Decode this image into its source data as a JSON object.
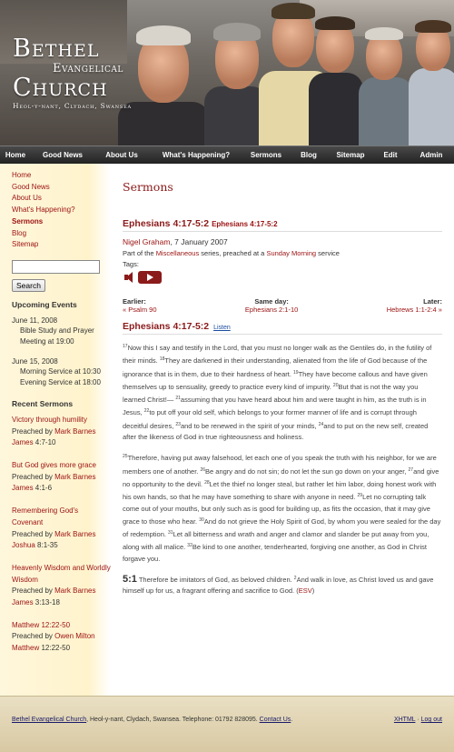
{
  "header": {
    "logo": {
      "line1": "Bethel",
      "line2": "Evangelical",
      "line3": "Church",
      "line4": "Heol-y-nant, Clydach, Swansea"
    }
  },
  "nav": [
    "Home",
    "Good News",
    "About Us",
    "What's Happening?",
    "Sermons",
    "Blog",
    "Sitemap",
    "Edit",
    "Admin"
  ],
  "sidebar": {
    "links": [
      "Home",
      "Good News",
      "About Us",
      "What's Happening?",
      "Sermons",
      "Blog",
      "Sitemap"
    ],
    "active": "Sermons",
    "search_button": "Search",
    "events_heading": "Upcoming Events",
    "events": [
      {
        "date": "June 11, 2008",
        "lines": [
          "Bible Study and Prayer",
          "Meeting at 19:00"
        ]
      },
      {
        "date": "June 15, 2008",
        "lines": [
          "Morning Service at 10:30",
          "Evening Service at 18:00"
        ]
      }
    ],
    "recent_heading": "Recent Sermons",
    "recent": [
      {
        "title": "Victory through humility",
        "by": "Preached by ",
        "preacher": "Mark Barnes",
        "ref_book": "James",
        "ref_rest": " 4:7-10"
      },
      {
        "title": "But God gives more grace",
        "by": "Preached by ",
        "preacher": "Mark Barnes",
        "ref_book": "James",
        "ref_rest": " 4:1-6"
      },
      {
        "title": "Remembering God's Covenant",
        "by": "Preached by ",
        "preacher": "Mark Barnes",
        "ref_book": "Joshua",
        "ref_rest": " 8:1-35"
      },
      {
        "title": "Heavenly Wisdom and Worldly Wisdom",
        "by": "Preached by ",
        "preacher": "Mark Barnes",
        "ref_book": "James",
        "ref_rest": " 3:13-18"
      },
      {
        "title": "Matthew 12:22-50",
        "by": "Preached by ",
        "preacher": "Owen Milton",
        "ref_book": "Matthew",
        "ref_rest": " 12:22-50"
      }
    ]
  },
  "main": {
    "page_title": "Sermons",
    "sermon_title": "Ephesians 4:17-5:2",
    "sermon_subtitle": "Ephesians 4:17-5:2",
    "preacher": "Nigel Graham",
    "date": ", 7 January 2007",
    "series_prefix": "Part of the ",
    "series": "Miscellaneous",
    "series_mid": " series, preached at a ",
    "service": "Sunday Morning",
    "series_suffix": " service",
    "tags_label": "Tags:",
    "earlier_label": "Earlier:",
    "earlier": "« Psalm 90",
    "sameday_label": "Same day:",
    "sameday": "Ephesians 2:1-10",
    "later_label": "Later:",
    "later": "Hebrews 1:1-2:4 »",
    "passage_heading": "Ephesians 4:17-5:2",
    "listen": "Listen",
    "para1": [
      {
        "n": "17",
        "t": "Now this I say and testify in the Lord, that you must no longer walk as the Gentiles do, in the futility of their minds. "
      },
      {
        "n": "18",
        "t": "They are darkened in their understanding, alienated from the life of God because of the ignorance that is in them, due to their hardness of heart. "
      },
      {
        "n": "19",
        "t": "They have become callous and have given themselves up to sensuality, greedy to practice every kind of impurity. "
      },
      {
        "n": "20",
        "t": "But that is not the way you learned Christ!— "
      },
      {
        "n": "21",
        "t": "assuming that you have heard about him and were taught in him, as the truth is in Jesus, "
      },
      {
        "n": "22",
        "t": "to put off your old self, which belongs to your former manner of life and is corrupt through deceitful desires, "
      },
      {
        "n": "23",
        "t": "and to be renewed in the spirit of your minds, "
      },
      {
        "n": "24",
        "t": "and to put on the new self, created after the likeness of God in true righteousness and holiness."
      }
    ],
    "para2": [
      {
        "n": "25",
        "t": "Therefore, having put away falsehood, let each one of you speak the truth with his neighbor, for we are members one of another. "
      },
      {
        "n": "26",
        "t": "Be angry and do not sin; do not let the sun go down on your anger, "
      },
      {
        "n": "27",
        "t": "and give no opportunity to the devil. "
      },
      {
        "n": "28",
        "t": "Let the thief no longer steal, but rather let him labor, doing honest work with his own hands, so that he may have something to share with anyone in need. "
      },
      {
        "n": "29",
        "t": "Let no corrupting talk come out of your mouths, but only such as is good for building up, as fits the occasion, that it may give grace to those who hear. "
      },
      {
        "n": "30",
        "t": "And do not grieve the Holy Spirit of God, by whom you were sealed for the day of redemption. "
      },
      {
        "n": "31",
        "t": "Let all bitterness and wrath and anger and clamor and slander be put away from you, along with all malice. "
      },
      {
        "n": "32",
        "t": "Be kind to one another, tenderhearted, forgiving one another, as God in Christ forgave you."
      }
    ],
    "ch5_label": "5:1",
    "para3_a": " Therefore be imitators of God, as beloved children. ",
    "para3_n": "2",
    "para3_b": "And walk in love, as Christ loved us and gave himself up for us, a fragrant offering and sacrifice to God. (",
    "esv": "ESV",
    "para3_c": ")"
  },
  "footer": {
    "church_link": "Bethel Evangelical Church",
    "address": ", Heol-y-nant, Clydach, Swansea. Telephone: 01792 828095. ",
    "contact_link": "Contact Us",
    "contact_end": ".",
    "xhtml": "XHTML",
    "sep": " · ",
    "logout": "Log out"
  },
  "colors": {
    "accent": "#8b1a1a",
    "nav_bg": "#2b2b2b",
    "sidebar_bg": "#fff4d0",
    "footer_bg": "#e2d5b3"
  }
}
